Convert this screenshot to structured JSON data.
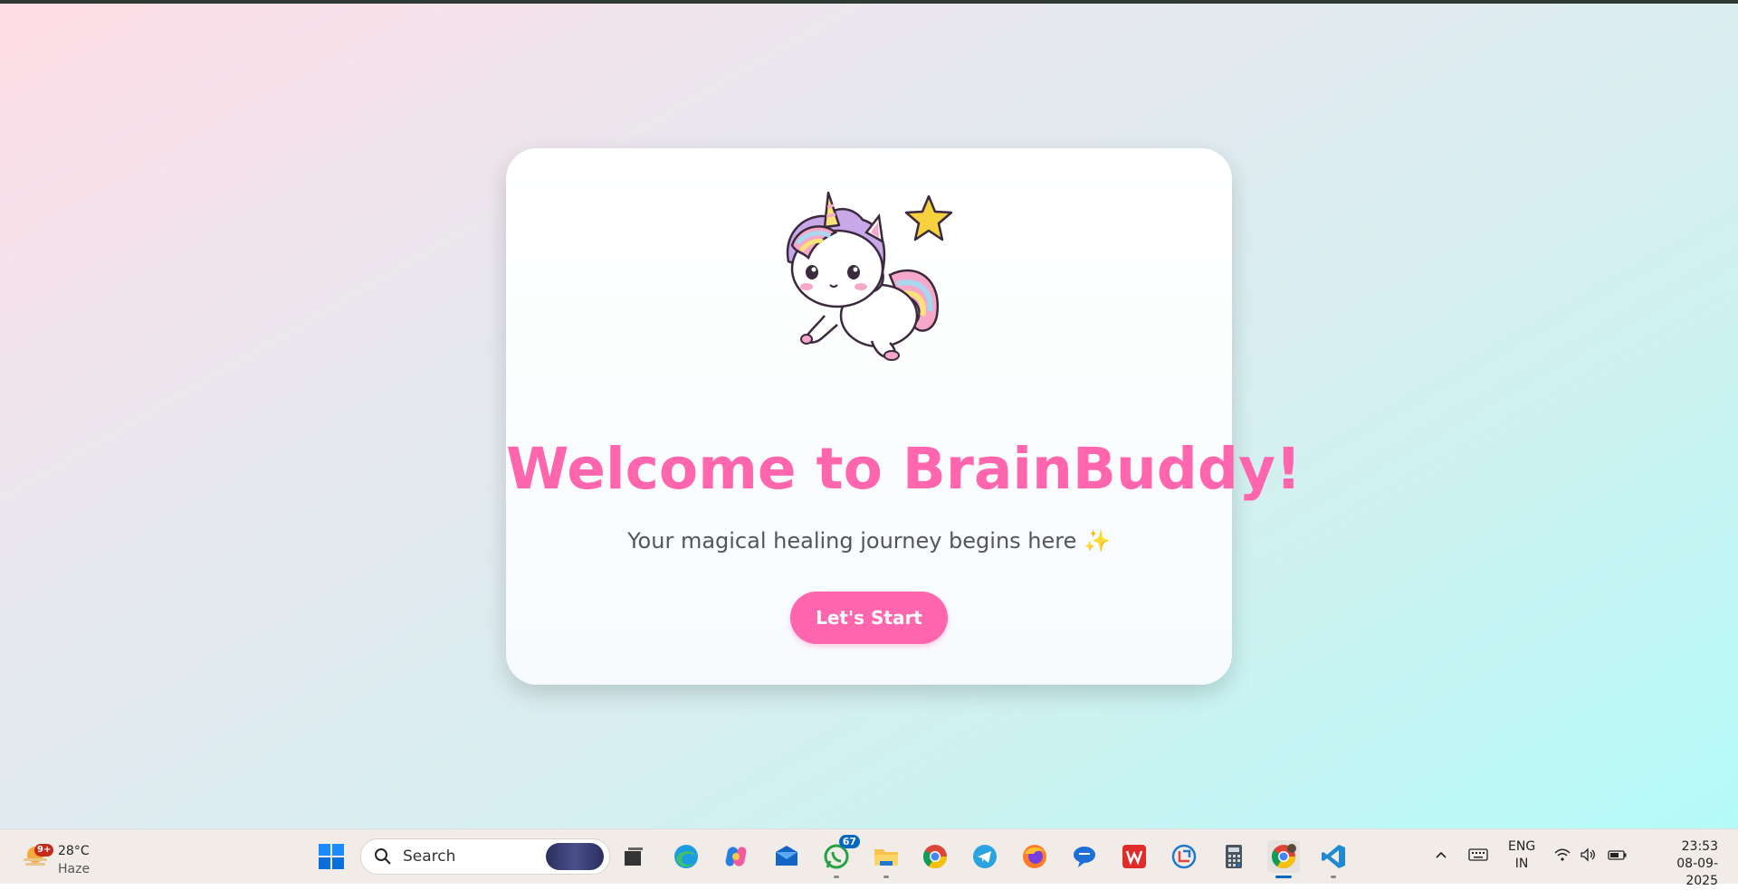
{
  "app": {
    "title": "Welcome to BrainBuddy!",
    "subtitle": "Your magical healing journey begins here",
    "sparkle": "✨",
    "start_label": "Let's Start"
  },
  "taskbar": {
    "weather": {
      "temp": "28°C",
      "condition": "Haze",
      "badge": "9+"
    },
    "search_placeholder": "Search",
    "apps": [
      {
        "name": "windows-start",
        "icon": "windows-logo-icon"
      },
      {
        "name": "task-view",
        "icon": "task-view-icon"
      },
      {
        "name": "edge",
        "icon": "edge-icon"
      },
      {
        "name": "copilot",
        "icon": "copilot-icon"
      },
      {
        "name": "mail",
        "icon": "mail-icon"
      },
      {
        "name": "whatsapp",
        "icon": "whatsapp-icon",
        "badge": "67"
      },
      {
        "name": "file-explorer",
        "icon": "folder-icon"
      },
      {
        "name": "chrome",
        "icon": "chrome-icon"
      },
      {
        "name": "telegram",
        "icon": "telegram-icon"
      },
      {
        "name": "firefox",
        "icon": "firefox-icon"
      },
      {
        "name": "messenger",
        "icon": "chat-icon"
      },
      {
        "name": "wps-office",
        "icon": "wps-icon"
      },
      {
        "name": "snipping-tool",
        "icon": "snip-icon"
      },
      {
        "name": "calculator",
        "icon": "calculator-icon"
      },
      {
        "name": "chrome-active",
        "icon": "chrome-icon"
      },
      {
        "name": "vscode",
        "icon": "vscode-icon"
      }
    ],
    "tray": {
      "lang_line1": "ENG",
      "lang_line2": "IN",
      "time": "23:53",
      "date": "08-09-2025"
    }
  },
  "colors": {
    "accent_pink": "#ff66ad",
    "windows_blue": "#0067c0"
  }
}
